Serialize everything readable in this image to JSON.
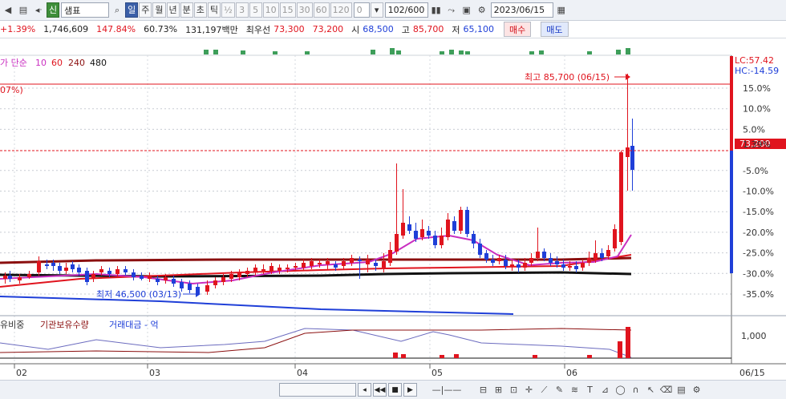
{
  "toolbar": {
    "stock_type": "신",
    "stock_name": "샘표",
    "periods": [
      "일",
      "주",
      "월",
      "년",
      "분",
      "초",
      "틱"
    ],
    "active_period": "일",
    "fraction_btn": "½",
    "intervals": [
      "3",
      "5",
      "10",
      "15",
      "30",
      "60",
      "120"
    ],
    "count_value": "0",
    "count_dropdown": "▾",
    "range_value": "102/600",
    "date_value": "2023/06/15"
  },
  "info": {
    "change_rate": "+1.39%",
    "volume": "1,746,609",
    "volume_ratio": "147.84%",
    "turnover": "60.73%",
    "amount": "131,197백만",
    "best_ask_label": "최우선",
    "best_ask": "73,300",
    "best_bid": "73,200",
    "open_label": "시",
    "open": "68,500",
    "high_label": "고",
    "high": "85,700",
    "low_label": "저",
    "low": "65,100",
    "buy_label": "매수",
    "sell_label": "매도"
  },
  "chart_data": {
    "type": "candlestick",
    "ma_legend": {
      "title": "가 단순",
      "periods": [
        "10",
        "60",
        "240",
        "480"
      ],
      "colors": {
        "10": "#c92fc0",
        "60": "#e0141e",
        "240": "#8b0f0f",
        "480": "#111111"
      }
    },
    "left_fragment": "07%)",
    "lc_text": "LC:57.42",
    "hc_text": "HC:-14.59",
    "current_price_label": "73,200",
    "high_annotation": "최고 85,700 (06/15)",
    "low_annotation": "최저 46,500 (03/13)",
    "y_ticks": [
      "15.0%",
      "10.0%",
      "5.0%",
      "1.39%",
      "-5.0%",
      "-10.0%",
      "-15.0%",
      "-20.0%",
      "-25.0%",
      "-30.0%",
      "-35.0%"
    ],
    "y_ticks_pct": [
      15,
      10,
      5,
      1.39,
      -5,
      -10,
      -15,
      -20,
      -25,
      -30,
      -35
    ],
    "x_labels": [
      "02",
      "03",
      "04",
      "05",
      "06"
    ],
    "x_label_date": "06/15",
    "sub_legend": [
      "유비중",
      "기관보유수량",
      "거래대금 - 억"
    ],
    "sub_legend_colors": [
      "#333333",
      "#8b0f0f",
      "#1f3fd8"
    ],
    "sub_tick": "1,000"
  },
  "colors": {
    "up": "#e0141e",
    "down": "#1f3fd8",
    "accent": "#3b5fa8"
  }
}
